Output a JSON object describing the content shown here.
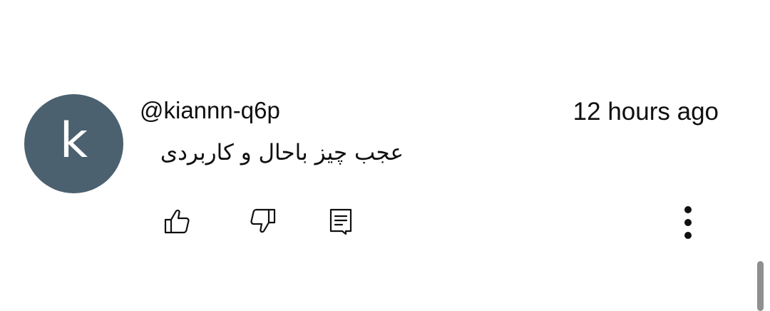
{
  "comment": {
    "avatar_letter": "k",
    "avatar_color": "#4c6170",
    "author": "@kiannn-q6p",
    "timestamp": "12 hours ago",
    "text": "عجب چیز باحال و کاربردی"
  },
  "actions": {
    "like_icon": "thumb-up-icon",
    "dislike_icon": "thumb-down-icon",
    "reply_icon": "comment-icon",
    "more_icon": "more-vertical-icon"
  }
}
